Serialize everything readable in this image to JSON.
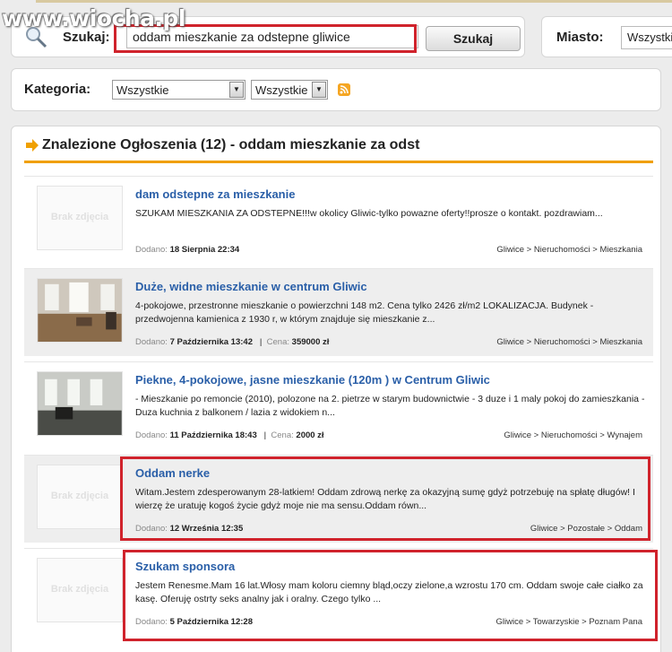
{
  "watermark": "www.wiocha.pl",
  "search": {
    "label": "Szukaj:",
    "value": "oddam mieszkanie za odstepne gliwice",
    "button": "Szukaj"
  },
  "city": {
    "label": "Miasto:",
    "value": "Wszystkie"
  },
  "category": {
    "label": "Kategoria:",
    "select1": "Wszystkie",
    "select2": "Wszystkie"
  },
  "results": {
    "title": "Znalezione Ogłoszenia (12) - oddam mieszkanie za odst"
  },
  "labels": {
    "added": "Dodano:",
    "price": "Cena:",
    "no_photo": "Brak zdjęcia"
  },
  "listings": [
    {
      "title": "dam odstepne za mieszkanie",
      "desc": "SZUKAM MIESZKANIA ZA ODSTEPNE!!!w okolicy Gliwic-tylko powazne oferty!!prosze o kontakt. pozdrawiam...",
      "date": "18 Sierpnia 22:34",
      "price": "",
      "path": "Gliwice > Nieruchomości > Mieszkania"
    },
    {
      "title": "Duże, widne mieszkanie w centrum Gliwic",
      "desc": "4-pokojowe, przestronne mieszkanie o powierzchni 148 m2. Cena tylko 2426 zł/m2 LOKALIZACJA. Budynek - przedwojenna kamienica z 1930 r, w którym znajduje się mieszkanie z...",
      "date": "7 Października 13:42",
      "price": "359000 zł",
      "path": "Gliwice > Nieruchomości > Mieszkania"
    },
    {
      "title": "Piekne, 4-pokojowe, jasne mieszkanie (120m ) w Centrum Gliwic",
      "desc": "- Mieszkanie po remoncie (2010), polozone na 2. pietrze w starym budownictwie - 3 duze i 1 maly pokoj do zamieszkania - Duza kuchnia z balkonem / lazia z widokiem n...",
      "date": "11 Października 18:43",
      "price": "2000 zł",
      "path": "Gliwice > Nieruchomości > Wynajem"
    },
    {
      "title": "Oddam nerke",
      "desc": "Witam.Jestem zdesperowanym 28-latkiem! Oddam zdrową nerkę za okazyjną sumę gdyż potrzebuję na spłatę długów! I wierzę że uratuję kogoś życie gdyż moje nie ma sensu.Oddam równ...",
      "date": "12 Września 12:35",
      "price": "",
      "path": "Gliwice > Pozostałe > Oddam"
    },
    {
      "title": "Szukam sponsora",
      "desc": "Jestem Renesme.Mam 16 lat.Włosy mam koloru ciemny bląd,oczy zielone,a wzrostu 170 cm. Oddam swoje całe ciałko za kasę. Oferuję ostrty seks analny jak i oralny. Czego tylko ...",
      "date": "5 Października 12:28",
      "price": "",
      "path": "Gliwice > Towarzyskie > Poznam Pana"
    }
  ],
  "colors": {
    "link": "#2a5fa8",
    "highlight": "#d0232c",
    "accent": "#f0a000"
  }
}
